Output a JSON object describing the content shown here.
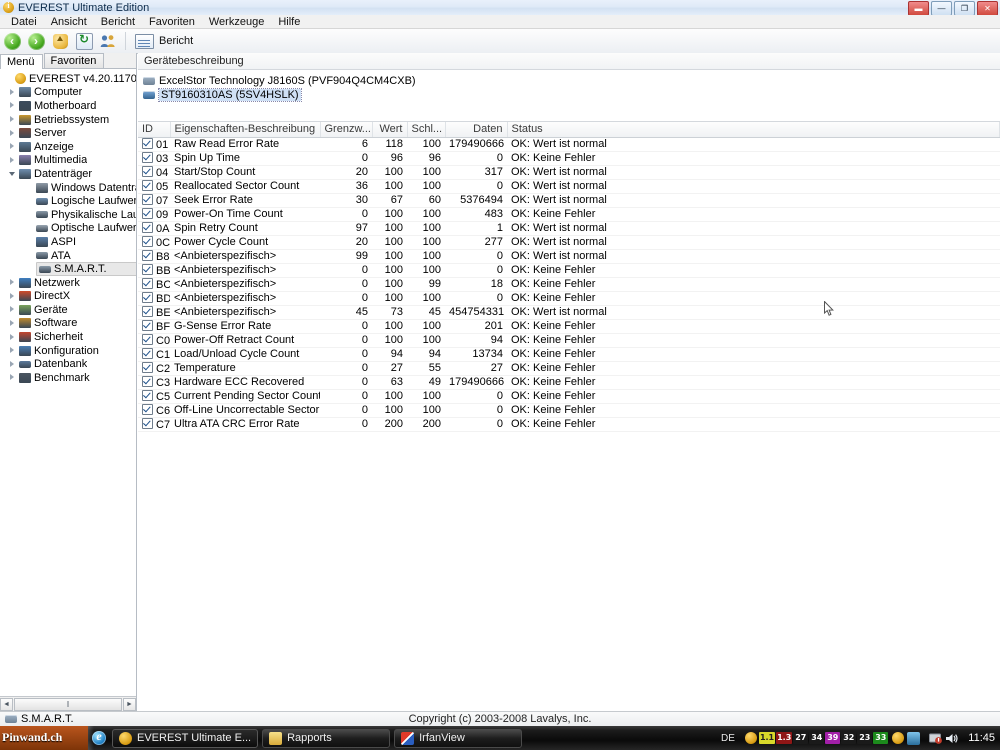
{
  "window": {
    "title": "EVEREST Ultimate Edition",
    "icon": "everest-info-icon",
    "buttons": [
      {
        "name": "restore-down-button",
        "glyph": "▬",
        "style": "red"
      },
      {
        "name": "minimize-button",
        "glyph": "—",
        "style": "plain"
      },
      {
        "name": "maximize-button",
        "glyph": "❐",
        "style": "plain"
      },
      {
        "name": "close-button",
        "glyph": "✕",
        "style": "red"
      }
    ]
  },
  "menubar": [
    "Datei",
    "Ansicht",
    "Bericht",
    "Favoriten",
    "Werkzeuge",
    "Hilfe"
  ],
  "toolbar": {
    "back": "back-icon",
    "forward": "forward-icon",
    "up": "up-folder-icon",
    "refresh": "refresh-icon",
    "users": "users-icon",
    "report_icon": "report-icon",
    "report_label": "Bericht"
  },
  "sidebar": {
    "tabs": [
      {
        "label": "Menü",
        "active": true
      },
      {
        "label": "Favoriten",
        "active": false
      }
    ],
    "root": {
      "label": "EVEREST v4.20.1170",
      "icon": "everest-info-icon"
    },
    "items": [
      {
        "label": "Computer",
        "icon": "computer-icon",
        "indent": 1,
        "expander": "collapsed",
        "color": "#6d8aa8"
      },
      {
        "label": "Motherboard",
        "icon": "motherboard-icon",
        "indent": 1,
        "expander": "collapsed",
        "color": "#3b4b5c"
      },
      {
        "label": "Betriebssystem",
        "icon": "os-icon",
        "indent": 1,
        "expander": "collapsed",
        "color": "#c9982f"
      },
      {
        "label": "Server",
        "icon": "server-icon",
        "indent": 1,
        "expander": "collapsed",
        "color": "#7b4a3c"
      },
      {
        "label": "Anzeige",
        "icon": "display-icon",
        "indent": 1,
        "expander": "collapsed",
        "color": "#5d7a94"
      },
      {
        "label": "Multimedia",
        "icon": "multimedia-icon",
        "indent": 1,
        "expander": "collapsed",
        "color": "#8a7fae"
      },
      {
        "label": "Datenträger",
        "icon": "storage-icon",
        "indent": 1,
        "expander": "open",
        "color": "#6f8fb0"
      },
      {
        "label": "Windows Datenträger",
        "icon": "windows-disk-icon",
        "indent": 2,
        "expander": "none",
        "color": "#8f9aa6"
      },
      {
        "label": "Logische Laufwerke",
        "icon": "logical-drive-icon",
        "indent": 2,
        "expander": "none",
        "color": "#6f8fb0"
      },
      {
        "label": "Physikalische Laufwerk",
        "icon": "physical-drive-icon",
        "indent": 2,
        "expander": "none",
        "color": "#8a9aa8"
      },
      {
        "label": "Optische Laufwerke",
        "icon": "optical-drive-icon",
        "indent": 2,
        "expander": "none",
        "color": "#9aa6b2"
      },
      {
        "label": "ASPI",
        "icon": "aspi-icon",
        "indent": 2,
        "expander": "none",
        "color": "#5a7fa8"
      },
      {
        "label": "ATA",
        "icon": "ata-icon",
        "indent": 2,
        "expander": "none",
        "color": "#8a9aa8"
      },
      {
        "label": "S.M.A.R.T.",
        "icon": "smart-icon",
        "indent": 2,
        "expander": "none",
        "color": "#8a9aa8",
        "selected": true
      },
      {
        "label": "Netzwerk",
        "icon": "network-icon",
        "indent": 1,
        "expander": "collapsed",
        "color": "#3f7fc0"
      },
      {
        "label": "DirectX",
        "icon": "directx-icon",
        "indent": 1,
        "expander": "collapsed",
        "color": "#cf4a2a"
      },
      {
        "label": "Geräte",
        "icon": "devices-icon",
        "indent": 1,
        "expander": "collapsed",
        "color": "#7aa35c"
      },
      {
        "label": "Software",
        "icon": "software-icon",
        "indent": 1,
        "expander": "collapsed",
        "color": "#c08a2e"
      },
      {
        "label": "Sicherheit",
        "icon": "security-icon",
        "indent": 1,
        "expander": "collapsed",
        "color": "#c4452e"
      },
      {
        "label": "Konfiguration",
        "icon": "configuration-icon",
        "indent": 1,
        "expander": "collapsed",
        "color": "#4b7fb5"
      },
      {
        "label": "Datenbank",
        "icon": "database-icon",
        "indent": 1,
        "expander": "collapsed",
        "color": "#5b7a9c"
      },
      {
        "label": "Benchmark",
        "icon": "benchmark-icon",
        "indent": 1,
        "expander": "collapsed",
        "color": "#4a5560"
      }
    ],
    "hscroll": {
      "left_arrow": "◄",
      "right_arrow": "►",
      "grip": "‖"
    }
  },
  "content": {
    "device_header": "Gerätebeschreibung",
    "devices": [
      {
        "name": "ExcelStor Technology J8160S (PVF904Q4CM4CXB)",
        "selected": false,
        "icon": "hdd-icon"
      },
      {
        "name": "ST9160310AS (5SV4HSLK)",
        "selected": true,
        "icon": "hdd-icon-blue"
      }
    ],
    "columns": [
      "ID",
      "Eigenschaften-Beschreibung",
      "Grenzw...",
      "Wert",
      "Schl...",
      "Daten",
      "Status"
    ],
    "rows": [
      {
        "id": "01",
        "desc": "Raw Read Error Rate",
        "threshold": "6",
        "value": "118",
        "worst": "100",
        "data": "179490666",
        "status": "OK: Wert ist normal",
        "checked": true
      },
      {
        "id": "03",
        "desc": "Spin Up Time",
        "threshold": "0",
        "value": "96",
        "worst": "96",
        "data": "0",
        "status": "OK: Keine Fehler",
        "checked": true
      },
      {
        "id": "04",
        "desc": "Start/Stop Count",
        "threshold": "20",
        "value": "100",
        "worst": "100",
        "data": "317",
        "status": "OK: Wert ist normal",
        "checked": true
      },
      {
        "id": "05",
        "desc": "Reallocated Sector Count",
        "threshold": "36",
        "value": "100",
        "worst": "100",
        "data": "0",
        "status": "OK: Wert ist normal",
        "checked": true
      },
      {
        "id": "07",
        "desc": "Seek Error Rate",
        "threshold": "30",
        "value": "67",
        "worst": "60",
        "data": "5376494",
        "status": "OK: Wert ist normal",
        "checked": true
      },
      {
        "id": "09",
        "desc": "Power-On Time Count",
        "threshold": "0",
        "value": "100",
        "worst": "100",
        "data": "483",
        "status": "OK: Keine Fehler",
        "checked": true
      },
      {
        "id": "0A",
        "desc": "Spin Retry Count",
        "threshold": "97",
        "value": "100",
        "worst": "100",
        "data": "1",
        "status": "OK: Wert ist normal",
        "checked": true
      },
      {
        "id": "0C",
        "desc": "Power Cycle Count",
        "threshold": "20",
        "value": "100",
        "worst": "100",
        "data": "277",
        "status": "OK: Wert ist normal",
        "checked": true
      },
      {
        "id": "B8",
        "desc": "<Anbieterspezifisch>",
        "threshold": "99",
        "value": "100",
        "worst": "100",
        "data": "0",
        "status": "OK: Wert ist normal",
        "checked": true
      },
      {
        "id": "BB",
        "desc": "<Anbieterspezifisch>",
        "threshold": "0",
        "value": "100",
        "worst": "100",
        "data": "0",
        "status": "OK: Keine Fehler",
        "checked": true
      },
      {
        "id": "BC",
        "desc": "<Anbieterspezifisch>",
        "threshold": "0",
        "value": "100",
        "worst": "99",
        "data": "18",
        "status": "OK: Keine Fehler",
        "checked": true
      },
      {
        "id": "BD",
        "desc": "<Anbieterspezifisch>",
        "threshold": "0",
        "value": "100",
        "worst": "100",
        "data": "0",
        "status": "OK: Keine Fehler",
        "checked": true
      },
      {
        "id": "BE",
        "desc": "<Anbieterspezifisch>",
        "threshold": "45",
        "value": "73",
        "worst": "45",
        "data": "454754331",
        "status": "OK: Wert ist normal",
        "checked": true
      },
      {
        "id": "BF",
        "desc": "G-Sense Error Rate",
        "threshold": "0",
        "value": "100",
        "worst": "100",
        "data": "201",
        "status": "OK: Keine Fehler",
        "checked": true
      },
      {
        "id": "C0",
        "desc": "Power-Off Retract Count",
        "threshold": "0",
        "value": "100",
        "worst": "100",
        "data": "94",
        "status": "OK: Keine Fehler",
        "checked": true
      },
      {
        "id": "C1",
        "desc": "Load/Unload Cycle Count",
        "threshold": "0",
        "value": "94",
        "worst": "94",
        "data": "13734",
        "status": "OK: Keine Fehler",
        "checked": true
      },
      {
        "id": "C2",
        "desc": "Temperature",
        "threshold": "0",
        "value": "27",
        "worst": "55",
        "data": "27",
        "status": "OK: Keine Fehler",
        "checked": true
      },
      {
        "id": "C3",
        "desc": "Hardware ECC Recovered",
        "threshold": "0",
        "value": "63",
        "worst": "49",
        "data": "179490666",
        "status": "OK: Keine Fehler",
        "checked": true
      },
      {
        "id": "C5",
        "desc": "Current Pending Sector Count",
        "threshold": "0",
        "value": "100",
        "worst": "100",
        "data": "0",
        "status": "OK: Keine Fehler",
        "checked": true
      },
      {
        "id": "C6",
        "desc": "Off-Line Uncorrectable Sector ...",
        "threshold": "0",
        "value": "100",
        "worst": "100",
        "data": "0",
        "status": "OK: Keine Fehler",
        "checked": true
      },
      {
        "id": "C7",
        "desc": "Ultra ATA CRC Error Rate",
        "threshold": "0",
        "value": "200",
        "worst": "200",
        "data": "0",
        "status": "OK: Keine Fehler",
        "checked": true
      }
    ]
  },
  "statusbar": {
    "label": "S.M.A.R.T.",
    "icon": "smart-icon",
    "copyright": "Copyright (c) 2003-2008 Lavalys, Inc."
  },
  "taskbar": {
    "brand": "Pinwand.ch",
    "ie_icon": "internet-explorer-icon",
    "buttons": [
      {
        "label": "EVEREST Ultimate E...",
        "icon": "everest-info-icon",
        "active": true
      },
      {
        "label": "Rapports",
        "icon": "folder-icon",
        "active": false
      },
      {
        "label": "IrfanView",
        "icon": "irfanview-icon",
        "active": false
      }
    ],
    "language": "DE",
    "tray_chips": [
      {
        "text": "",
        "bg": "#d79b12",
        "name": "tray-everest-icon"
      },
      {
        "text": "1.1",
        "bg": "#d8d82a",
        "fg": "#222222"
      },
      {
        "text": "1.3",
        "bg": "#8f1616"
      },
      {
        "text": "27",
        "bg": "#1a1a1a"
      },
      {
        "text": "34",
        "bg": "#1a1a1a"
      },
      {
        "text": "39",
        "bg": "#a21fa8"
      },
      {
        "text": "32",
        "bg": "#1a1a1a"
      },
      {
        "text": "23",
        "bg": "#1a1a1a"
      },
      {
        "text": "33",
        "bg": "#1c8a1c"
      }
    ],
    "tray_icons": [
      "everest-tray-icon",
      "network-tray-icon",
      "action-center-icon",
      "volume-icon"
    ],
    "clock": "11:45"
  },
  "colors": {
    "accent": "#3b6ea5",
    "titlebar": "#dfeaf7",
    "selection": "#cfe0f5"
  }
}
